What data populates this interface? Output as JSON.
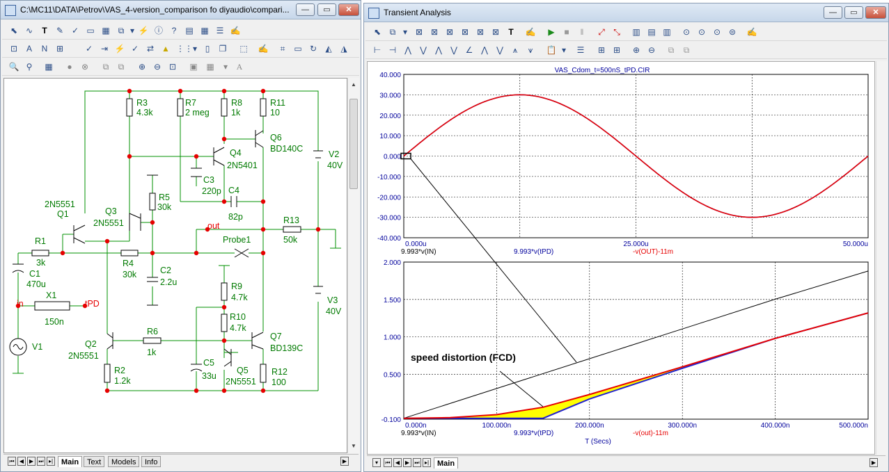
{
  "left_window": {
    "title": "C:\\MC11\\DATA\\Petrov\\VAS_4-version_comparison fo diyaudio\\compari...",
    "tabs": [
      "Main",
      "Text",
      "Models",
      "Info"
    ],
    "active_tab": "Main"
  },
  "schematic": {
    "components": {
      "R3": [
        "R3",
        "4.3k"
      ],
      "R7": [
        "R7",
        "2 meg"
      ],
      "R8": [
        "R8",
        "1k"
      ],
      "R11": [
        "R11",
        "10"
      ],
      "Q6": [
        "Q6",
        "BD140C"
      ],
      "Q4": [
        "Q4",
        "2N5401"
      ],
      "V2": [
        "V2",
        "40V"
      ],
      "C3": [
        "C3",
        "220p"
      ],
      "C4": [
        "C4",
        "82p"
      ],
      "R5": [
        "R5",
        "30k"
      ],
      "Q1": [
        "2N5551",
        "Q1"
      ],
      "Q3": [
        "Q3",
        "2N5551"
      ],
      "R13": [
        "R13",
        "50k"
      ],
      "R1": [
        "R1",
        "3k"
      ],
      "R4": [
        "R4",
        "30k"
      ],
      "C2": [
        "C2",
        "2.2u"
      ],
      "C1": [
        "C1",
        "470u"
      ],
      "X1": [
        "X1",
        "150n"
      ],
      "V1": [
        "V1"
      ],
      "R9": [
        "R9",
        "4.7k"
      ],
      "R10": [
        "R10",
        "4.7k"
      ],
      "V3": [
        "V3",
        "40V"
      ],
      "Q2": [
        "Q2",
        "2N5551"
      ],
      "R6": [
        "R6",
        "1k"
      ],
      "Q7": [
        "Q7",
        "BD139C"
      ],
      "C5": [
        "C5",
        "33u"
      ],
      "Q5": [
        "Q5",
        "2N5551"
      ],
      "R12": [
        "R12",
        "100"
      ],
      "R2": [
        "R2",
        "1.2k"
      ],
      "Probe1": [
        "Probe1"
      ]
    },
    "nodes": {
      "in": "in",
      "out": "out",
      "tPD": "tPD"
    }
  },
  "right_window": {
    "title": "Transient Analysis",
    "tabs": [
      "Main"
    ],
    "active_tab": "Main"
  },
  "chart_data": [
    {
      "type": "line",
      "title": "VAS_Cdom_t=500nS_tPD.CIR",
      "xlim": [
        0,
        50
      ],
      "ylim": [
        -40,
        40
      ],
      "x_ticks": [
        "0.000u",
        "25.000u",
        "50.000u"
      ],
      "y_ticks": [
        "40.000",
        "30.000",
        "20.000",
        "10.000",
        "0.000",
        "-10.000",
        "-20.000",
        "-30.000",
        "-40.000"
      ],
      "grid": true,
      "trace_labels": [
        "9.993*v(IN)",
        "9.993*v(tPD)",
        "-v(OUT)-11m"
      ],
      "series": [
        {
          "name": "9.993*v(tPD)",
          "color": "#2020d0",
          "x": [
            0,
            6.25,
            12.5,
            18.75,
            25,
            31.25,
            37.5,
            43.75,
            50
          ],
          "y": [
            0,
            21.2,
            30,
            21.2,
            0,
            -21.2,
            -30,
            -21.2,
            0
          ]
        },
        {
          "name": "-v(OUT)-11m",
          "color": "#e60000",
          "x": [
            0,
            6.25,
            12.5,
            18.75,
            25,
            31.25,
            37.5,
            43.75,
            50
          ],
          "y": [
            0,
            21.2,
            30,
            21.2,
            0,
            -21.2,
            -30,
            -21.2,
            0
          ]
        }
      ],
      "annotation_box_color": "#000000"
    },
    {
      "type": "line",
      "xlim": [
        0,
        500
      ],
      "ylim": [
        -0.1,
        2.0
      ],
      "x_ticks": [
        "0.000n",
        "100.000n",
        "200.000n",
        "300.000n",
        "400.000n",
        "500.000n"
      ],
      "y_ticks": [
        "2.000",
        "1.500",
        "1.000",
        "0.500",
        "-0.100"
      ],
      "xlabel": "T (Secs)",
      "grid": true,
      "trace_labels": [
        "9.993*v(IN)",
        "9.993*v(tPD)",
        "-v(out)-11m"
      ],
      "series": [
        {
          "name": "9.993*v(IN)",
          "color": "#000000",
          "x": [
            0,
            100,
            200,
            300,
            400,
            500
          ],
          "y": [
            -0.088,
            0.31,
            0.708,
            1.106,
            1.504,
            1.88
          ]
        },
        {
          "name": "9.993*v(tPD)",
          "color": "#2020d0",
          "x": [
            0,
            150,
            200,
            300,
            400,
            500
          ],
          "y": [
            -0.088,
            -0.088,
            0.17,
            0.58,
            0.98,
            1.32
          ]
        },
        {
          "name": "-v(out)-11m",
          "color": "#e60000",
          "x": [
            0,
            50,
            100,
            150,
            200,
            300,
            400,
            500
          ],
          "y": [
            -0.088,
            -0.08,
            -0.04,
            0.06,
            0.23,
            0.6,
            0.98,
            1.32
          ]
        }
      ],
      "fill_color": "#ffff00",
      "annotation": "speed distortion (FCD)"
    }
  ]
}
